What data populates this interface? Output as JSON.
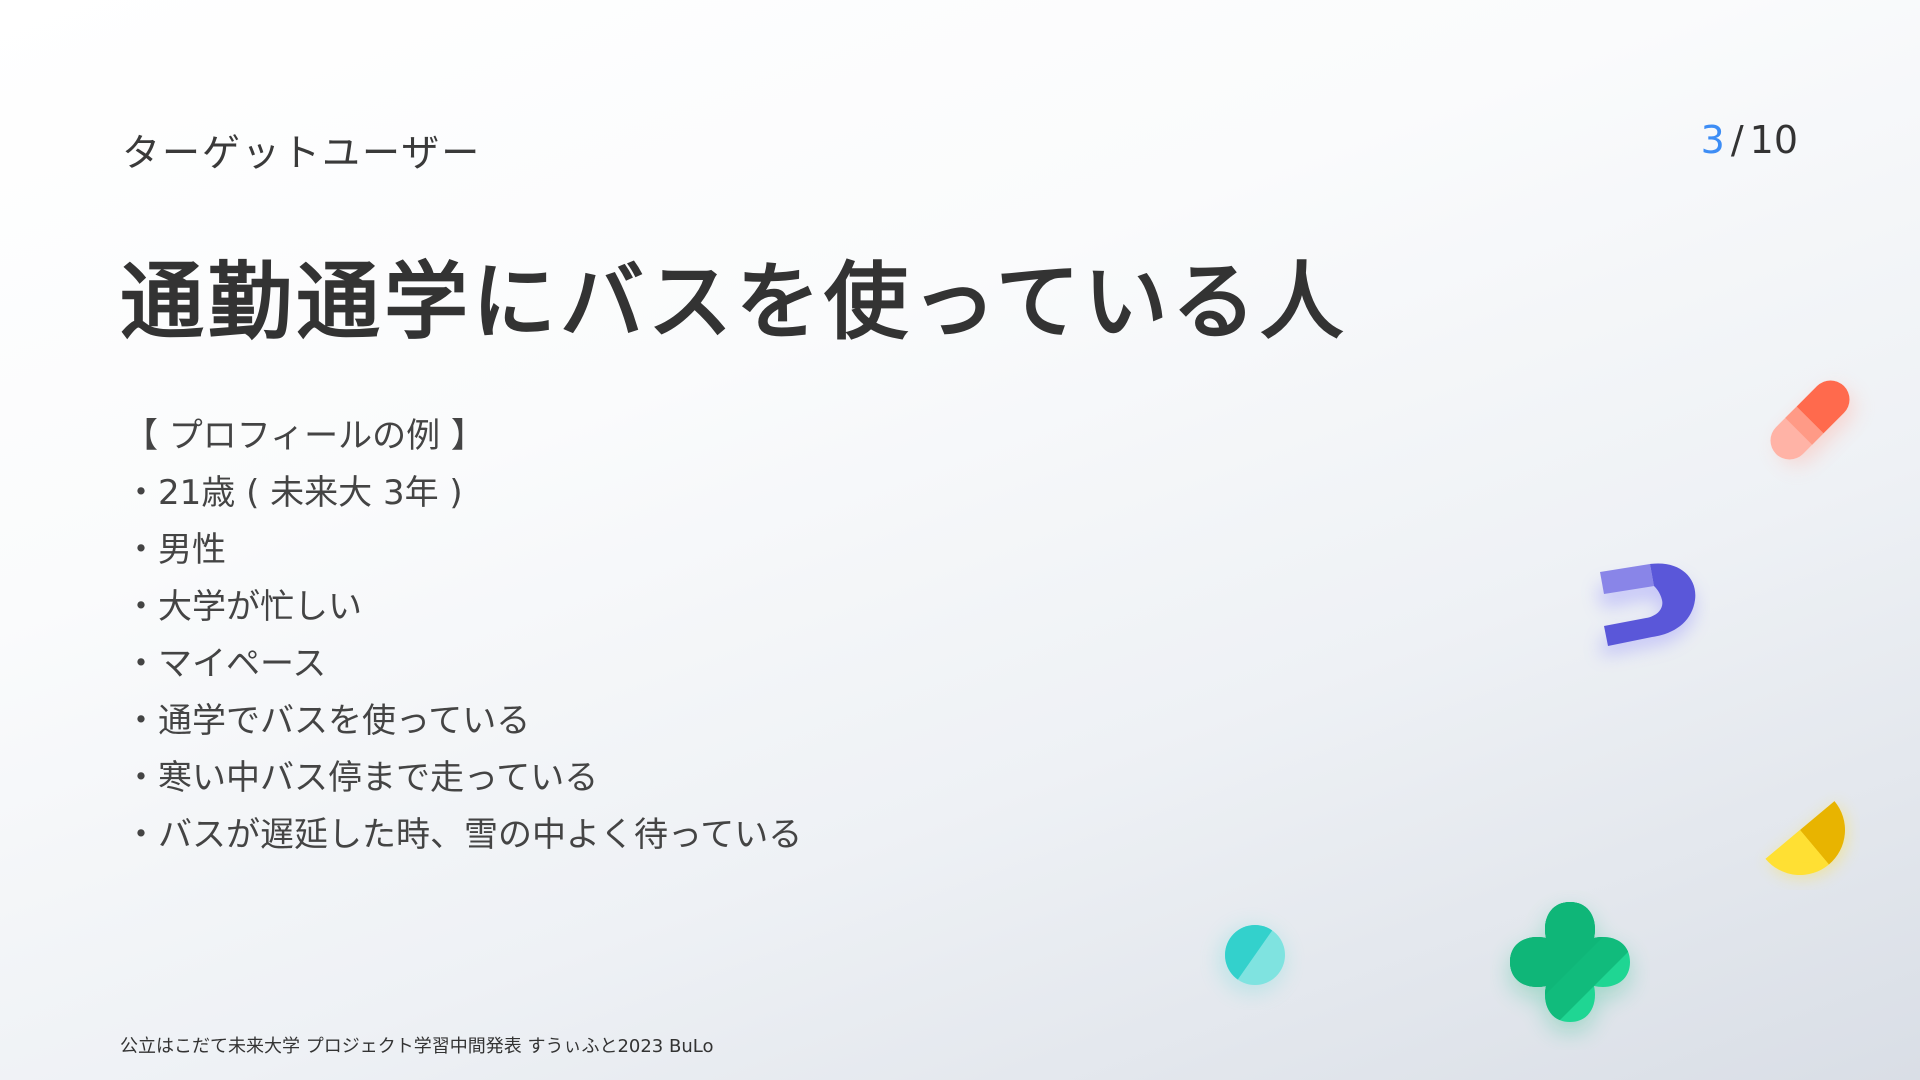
{
  "header": {
    "section_label": "ターゲットユーザー",
    "page_current": "3",
    "page_separator": "/",
    "page_total": "10"
  },
  "headline": "通勤通学にバスを使っている人",
  "profile": {
    "heading": "【 プロフィールの例 】",
    "items": [
      "・21歳 ( 未来大 3年 )",
      "・男性",
      "・大学が忙しい",
      "・マイペース",
      "・通学でバスを使っている",
      "・寒い中バス停まで走っている",
      "・バスが遅延した時、雪の中よく待っている"
    ]
  },
  "footer": "公立はこだて未来大学 プロジェクト学習中間発表 すうぃふと2023 BuLo",
  "colors": {
    "accent_blue": "#3d8df5",
    "pill_red": "#ff6a4d",
    "pill_pink": "#ffb3a6",
    "magnet_purple": "#5a57d9",
    "half_yellow": "#ffe033",
    "half_gold": "#e8b400",
    "circle_teal": "#33d1cc",
    "clover_green": "#10b87a"
  },
  "decorations": [
    "capsule-icon",
    "magnet-icon",
    "half-circle-icon",
    "teal-circle-icon",
    "clover-icon"
  ]
}
